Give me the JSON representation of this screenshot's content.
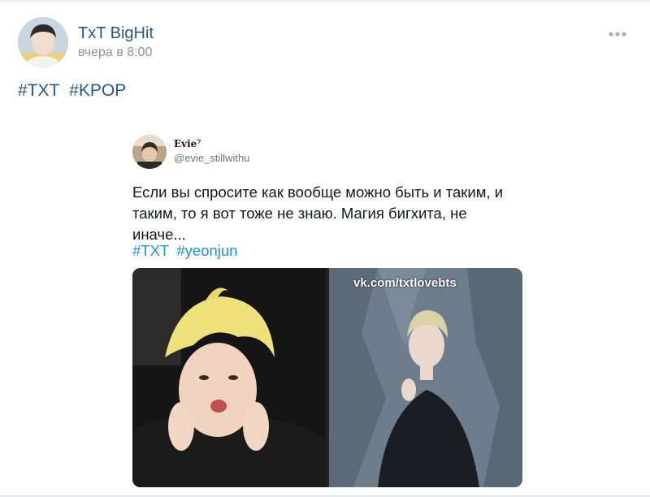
{
  "post": {
    "author": "TxT BigHit",
    "time": "вчера в 8:00",
    "tags": [
      "#TXT",
      "#KPOP"
    ]
  },
  "tweet": {
    "name": "Evie⁷",
    "handle": "@evie_stillwithu",
    "text": "Если вы спросите как вообще можно быть и таким, и таким, то я вот тоже не знаю. Магия бигхита, не иначе...",
    "tags": [
      "#TXT",
      "#yeonjun"
    ],
    "watermark": "vk.com/txtlovebts"
  },
  "icons": {
    "more": "more-horizontal-icon"
  },
  "colors": {
    "link": "#2a5885",
    "tweet_link": "#1b95e0",
    "meta": "#939393"
  }
}
